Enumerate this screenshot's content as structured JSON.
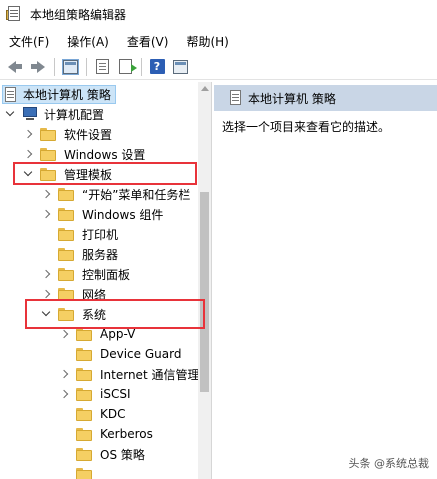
{
  "window": {
    "title": "本地组策略编辑器"
  },
  "menu": [
    "文件(F)",
    "操作(A)",
    "查看(V)",
    "帮助(H)"
  ],
  "toolbar": {
    "help_glyph": "?"
  },
  "tree": {
    "root": "本地计算机 策略",
    "computer_config": "计算机配置",
    "items": [
      {
        "label": "软件设置",
        "level": 1,
        "expand": "right"
      },
      {
        "label": "Windows 设置",
        "level": 1,
        "expand": "right"
      },
      {
        "label": "管理模板",
        "level": 1,
        "expand": "down"
      },
      {
        "label": "“开始”菜单和任务栏",
        "level": 2,
        "expand": "right"
      },
      {
        "label": "Windows 组件",
        "level": 2,
        "expand": "right"
      },
      {
        "label": "打印机",
        "level": 2,
        "expand": "none"
      },
      {
        "label": "服务器",
        "level": 2,
        "expand": "none"
      },
      {
        "label": "控制面板",
        "level": 2,
        "expand": "right"
      },
      {
        "label": "网络",
        "level": 2,
        "expand": "right"
      },
      {
        "label": "系统",
        "level": 2,
        "expand": "down"
      },
      {
        "label": "App-V",
        "level": 3,
        "expand": "right"
      },
      {
        "label": "Device Guard",
        "level": 3,
        "expand": "none"
      },
      {
        "label": "Internet 通信管理",
        "level": 3,
        "expand": "right"
      },
      {
        "label": "iSCSI",
        "level": 3,
        "expand": "right"
      },
      {
        "label": "KDC",
        "level": 3,
        "expand": "none"
      },
      {
        "label": "Kerberos",
        "level": 3,
        "expand": "none"
      },
      {
        "label": "OS 策略",
        "level": 3,
        "expand": "none"
      },
      {
        "label": "",
        "level": 3,
        "expand": "none"
      }
    ]
  },
  "right": {
    "header": "本地计算机 策略",
    "description": "选择一个项目来查看它的描述。"
  },
  "watermark": "头条 @系统总裁",
  "colors": {
    "highlight": "#e8333a",
    "selection": "#cce4f7",
    "header_bg": "#c9d6e6",
    "folder": "#f5cf63"
  }
}
